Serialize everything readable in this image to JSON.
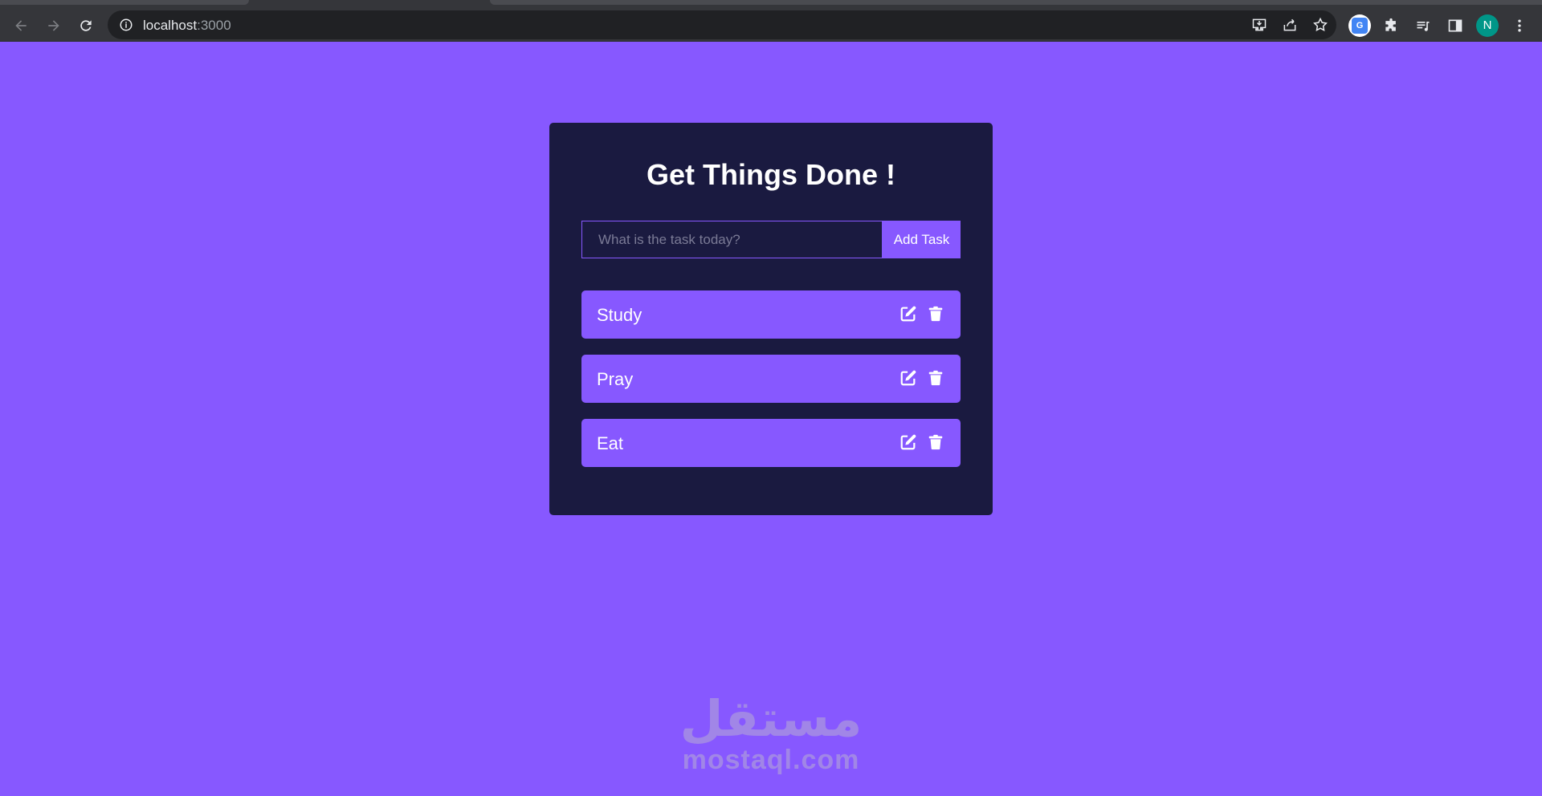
{
  "browser": {
    "url_host": "localhost",
    "url_port": ":3000",
    "profile_initial": "N",
    "extension_badge": "G"
  },
  "app": {
    "title": "Get Things Done !",
    "input_placeholder": "What is the task today?",
    "input_value": "",
    "add_button_label": "Add Task",
    "tasks": [
      {
        "label": "Study"
      },
      {
        "label": "Pray"
      },
      {
        "label": "Eat"
      }
    ]
  },
  "watermark": {
    "arabic": "مستقل",
    "latin": "mostaql.com"
  },
  "colors": {
    "background": "#8758ff",
    "card": "#1a1a40",
    "accent": "#8758ff"
  }
}
